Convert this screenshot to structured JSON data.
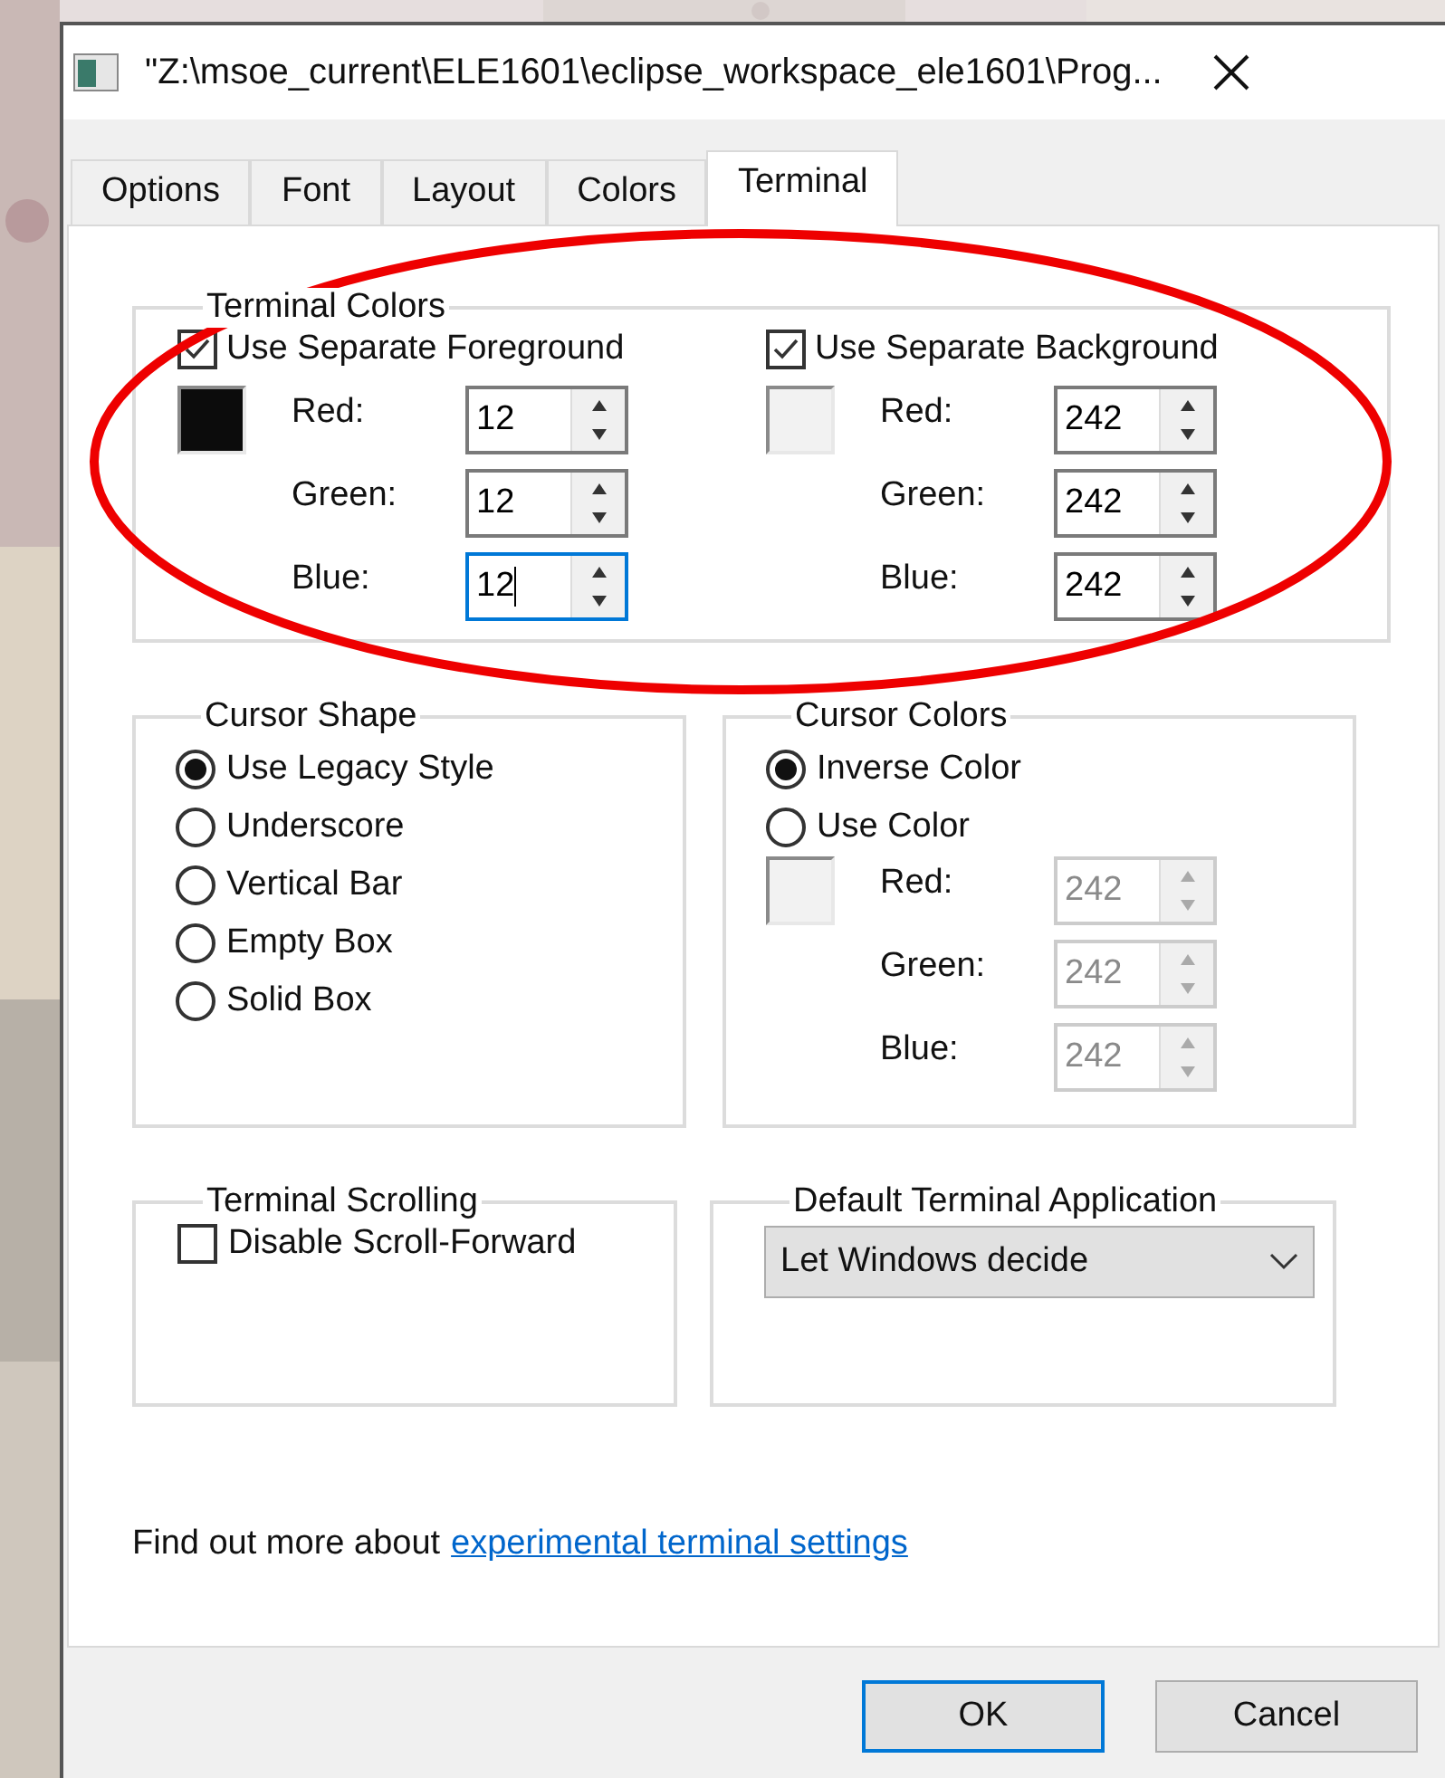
{
  "window": {
    "title": "\"Z:\\msoe_current\\ELE1601\\eclipse_workspace_ele1601\\Prog..."
  },
  "tabs": [
    {
      "label": "Options",
      "selected": false
    },
    {
      "label": "Font",
      "selected": false
    },
    {
      "label": "Layout",
      "selected": false
    },
    {
      "label": "Colors",
      "selected": false
    },
    {
      "label": "Terminal",
      "selected": true
    }
  ],
  "terminal_colors": {
    "title": "Terminal Colors",
    "columns": [
      {
        "label": "Use Separate Foreground",
        "checked": true,
        "color": "#0c0c0c",
        "fields": [
          {
            "label": "Red:",
            "value": "12",
            "focused": false
          },
          {
            "label": "Green:",
            "value": "12",
            "focused": false
          },
          {
            "label": "Blue:",
            "value": "12",
            "focused": true
          }
        ]
      },
      {
        "label": "Use Separate Background",
        "checked": true,
        "color": "#f2f2f2",
        "fields": [
          {
            "label": "Red:",
            "value": "242",
            "focused": false
          },
          {
            "label": "Green:",
            "value": "242",
            "focused": false
          },
          {
            "label": "Blue:",
            "value": "242",
            "focused": false
          }
        ]
      }
    ]
  },
  "cursor_shape": {
    "title": "Cursor Shape",
    "options": [
      {
        "label": "Use Legacy Style",
        "selected": true
      },
      {
        "label": "Underscore",
        "selected": false
      },
      {
        "label": "Vertical Bar",
        "selected": false
      },
      {
        "label": "Empty Box",
        "selected": false
      },
      {
        "label": "Solid Box",
        "selected": false
      }
    ]
  },
  "cursor_colors": {
    "title": "Cursor Colors",
    "options": [
      {
        "label": "Inverse Color",
        "selected": true
      },
      {
        "label": "Use Color",
        "selected": false
      }
    ],
    "color": "#f2f2f2",
    "disabled": true,
    "fields": [
      {
        "label": "Red:",
        "value": "242"
      },
      {
        "label": "Green:",
        "value": "242"
      },
      {
        "label": "Blue:",
        "value": "242"
      }
    ]
  },
  "terminal_scrolling": {
    "title": "Terminal Scrolling",
    "checkbox": {
      "label": "Disable Scroll-Forward",
      "checked": false
    }
  },
  "default_terminal": {
    "title": "Default Terminal Application",
    "dropdown": {
      "value": "Let Windows decide"
    }
  },
  "footer": {
    "text": "Find out more about",
    "link": "experimental terminal settings"
  },
  "buttons": [
    {
      "label": "OK",
      "default": true
    },
    {
      "label": "Cancel",
      "default": false
    }
  ],
  "annotations": [
    {
      "kind": "ellipse"
    }
  ]
}
